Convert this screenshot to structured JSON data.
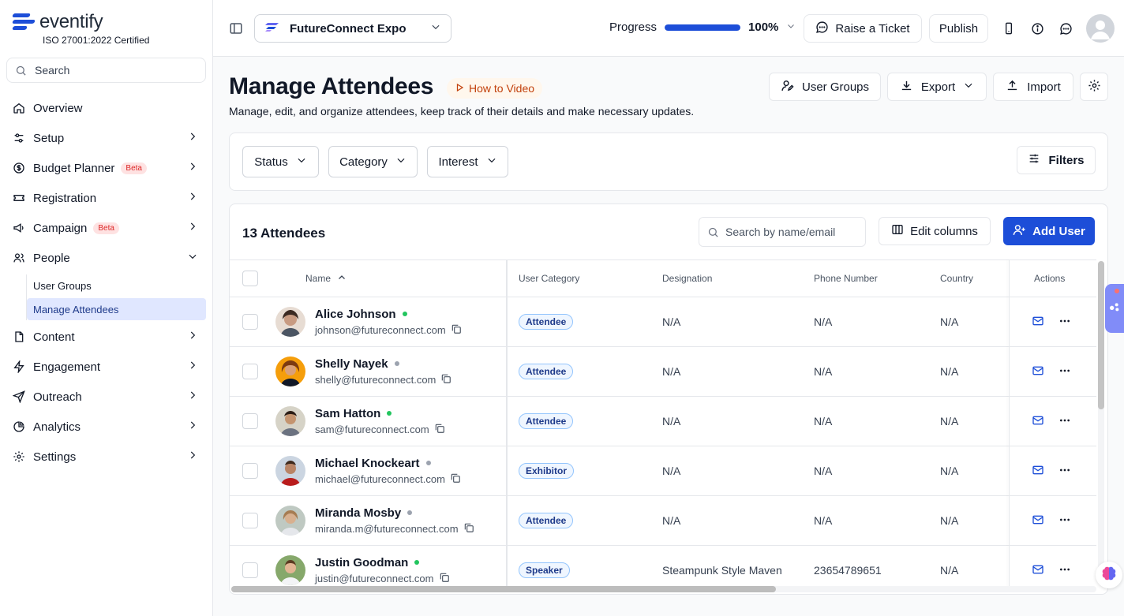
{
  "brand": {
    "name": "eventify",
    "certification": "ISO 27001:2022 Certified"
  },
  "sidebar": {
    "search_placeholder": "Search",
    "items": [
      {
        "label": "Overview",
        "icon": "home-icon"
      },
      {
        "label": "Setup",
        "icon": "sliders-icon"
      },
      {
        "label": "Budget Planner",
        "icon": "dollar-icon",
        "badge": "Beta"
      },
      {
        "label": "Registration",
        "icon": "ticket-icon"
      },
      {
        "label": "Campaign",
        "icon": "megaphone-icon",
        "badge": "Beta"
      },
      {
        "label": "People",
        "icon": "users-icon",
        "expanded": true
      },
      {
        "label": "Content",
        "icon": "file-icon"
      },
      {
        "label": "Engagement",
        "icon": "bolt-icon"
      },
      {
        "label": "Outreach",
        "icon": "send-icon"
      },
      {
        "label": "Analytics",
        "icon": "pie-chart-icon"
      },
      {
        "label": "Settings",
        "icon": "gear-icon"
      }
    ],
    "people_sub": [
      {
        "label": "User Groups",
        "active": false
      },
      {
        "label": "Manage Attendees",
        "active": true
      }
    ]
  },
  "topbar": {
    "event_name": "FutureConnect Expo",
    "progress_label": "Progress",
    "progress_value": 100,
    "progress_text": "100%",
    "raise_ticket": "Raise a Ticket",
    "publish": "Publish"
  },
  "page": {
    "title": "Manage Attendees",
    "how_to": "How to Video",
    "description": "Manage, edit, and organize attendees, keep track of their details and make necessary updates.",
    "user_groups": "User Groups",
    "export": "Export",
    "import": "Import"
  },
  "filters": {
    "status": "Status",
    "category": "Category",
    "interest": "Interest",
    "filters": "Filters"
  },
  "table": {
    "count": "13 Attendees",
    "search_placeholder": "Search by name/email",
    "edit_columns": "Edit columns",
    "add_user": "Add User",
    "columns": {
      "name": "Name",
      "category": "User Category",
      "designation": "Designation",
      "phone": "Phone Number",
      "country": "Country",
      "actions": "Actions"
    },
    "rows": [
      {
        "name": "Alice Johnson",
        "email": "johnson@futureconnect.com",
        "online": true,
        "category": "Attendee",
        "designation": "N/A",
        "phone": "N/A",
        "country": "N/A"
      },
      {
        "name": "Shelly Nayek",
        "email": "shelly@futureconnect.com",
        "online": false,
        "category": "Attendee",
        "designation": "N/A",
        "phone": "N/A",
        "country": "N/A"
      },
      {
        "name": "Sam Hatton",
        "email": "sam@futureconnect.com",
        "online": true,
        "category": "Attendee",
        "designation": "N/A",
        "phone": "N/A",
        "country": "N/A"
      },
      {
        "name": "Michael Knockeart",
        "email": "michael@futureconnect.com",
        "online": false,
        "category": "Exhibitor",
        "designation": "N/A",
        "phone": "N/A",
        "country": "N/A"
      },
      {
        "name": "Miranda Mosby",
        "email": "miranda.m@futureconnect.com",
        "online": false,
        "category": "Attendee",
        "designation": "N/A",
        "phone": "N/A",
        "country": "N/A"
      },
      {
        "name": "Justin Goodman",
        "email": "justin@futureconnect.com",
        "online": true,
        "category": "Speaker",
        "designation": "Steampunk Style Maven",
        "phone": "23654789651",
        "country": "N/A"
      }
    ]
  },
  "colors": {
    "accent": "#1d4ed8",
    "online": "#22c55e",
    "offline": "#9ca3af",
    "beta": "#dc2626"
  }
}
